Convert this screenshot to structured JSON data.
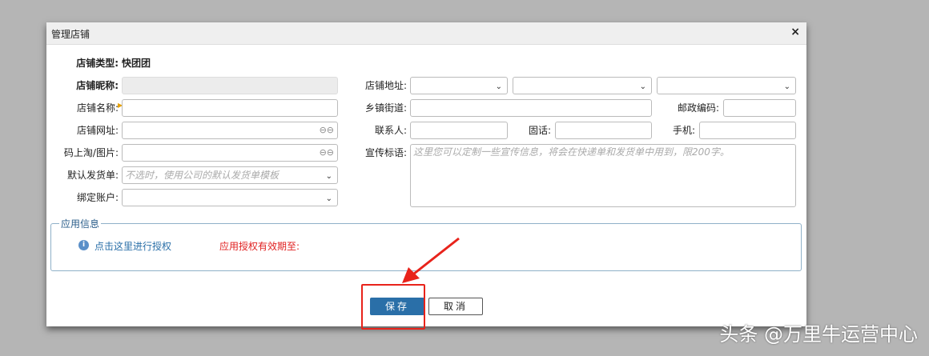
{
  "dialog": {
    "title": "管理店铺",
    "close": "×"
  },
  "left": {
    "store_type_label": "店铺类型:",
    "store_type_value": "快团团",
    "nickname_label": "店铺昵称:",
    "name_label": "店铺名称:",
    "url_label": "店铺网址:",
    "image_label": "码上淘/图片:",
    "invoice_label": "默认发货单:",
    "invoice_placeholder": "不选时，使用公司的默认发货单模板",
    "account_label": "绑定账户:"
  },
  "right": {
    "address_label": "店铺地址:",
    "street_label": "乡镇街道:",
    "postcode_label": "邮政编码:",
    "contact_label": "联系人:",
    "phone_label": "固话:",
    "mobile_label": "手机:",
    "slogan_label": "宣传标语:",
    "slogan_placeholder": "这里您可以定制一些宣传信息，将会在快递单和发货单中用到，限200字。"
  },
  "app_info": {
    "legend": "应用信息",
    "authorize_link": "点击这里进行授权",
    "expiry_label": "应用授权有效期至:"
  },
  "buttons": {
    "save": "保存",
    "cancel": "取消"
  },
  "watermark": "头条 @万里牛运营中心",
  "colors": {
    "primary": "#2a6fa8",
    "danger": "#e02020"
  }
}
